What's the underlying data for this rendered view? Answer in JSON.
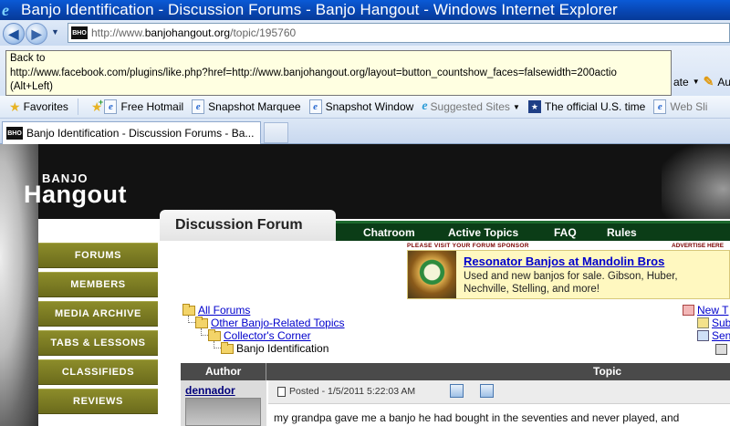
{
  "browser": {
    "window_title": "Banjo Identification - Discussion Forums - Banjo Hangout - Windows Internet Explorer",
    "url_prefix": "http://www.",
    "url_domain": "banjohangout.org",
    "url_path": "/topic/195760",
    "favicon_text": "BHO",
    "tooltip_line1": "Back to",
    "tooltip_line2": "http://www.facebook.com/plugins/like.php?href=http://www.banjohangout.org/layout=button_countshow_faces=falsewidth=200actio",
    "tooltip_line3": "(Alt+Left)",
    "command_page_label": "ate",
    "command_au_label": "Au"
  },
  "favorites_bar": {
    "favorites_label": "Favorites",
    "items": [
      {
        "label": "Free Hotmail",
        "icon": "ie-page-icon"
      },
      {
        "label": "Snapshot Marquee",
        "icon": "ie-page-icon"
      },
      {
        "label": "Snapshot Window",
        "icon": "ie-page-icon"
      },
      {
        "label": "Suggested Sites",
        "icon": "ie-e-icon"
      },
      {
        "label": "The official U.S. time",
        "icon": "usgov-icon"
      },
      {
        "label": "Web Sli",
        "icon": "ie-page-icon"
      }
    ]
  },
  "tabs": [
    {
      "title": "Banjo Identification - Discussion Forums - Ba..."
    }
  ],
  "site": {
    "logo_small": "BANJO",
    "logo_big": "Hangout",
    "sidebar": [
      "FORUMS",
      "MEMBERS",
      "MEDIA ARCHIVE",
      "TABS & LESSONS",
      "CLASSIFIEDS",
      "REVIEWS"
    ],
    "section_title": "Discussion Forum",
    "nav": [
      "Chatroom",
      "Active Topics",
      "FAQ",
      "Rules"
    ],
    "sponsor_label": "PLEASE VISIT YOUR FORUM SPONSOR",
    "advertise_label": "ADVERTISE HERE",
    "ad": {
      "title": "Resonator Banjos at Mandolin Bros",
      "description": "Used and new banjos for sale. Gibson, Huber, Nechville, Stelling, and more!"
    },
    "breadcrumbs": [
      "All Forums",
      "Other Banjo-Related Topics",
      "Collector's Corner",
      "Banjo Identification"
    ],
    "right_links": [
      "New T",
      "Sub",
      "Sen"
    ],
    "table": {
      "author_header": "Author",
      "topic_header": "Topic"
    },
    "post": {
      "author": "dennador",
      "meta": "Posted - 1/5/2011 5:22:03 AM",
      "body": "my grandpa gave me a banjo he had bought in the seventies and never played, and"
    }
  },
  "colors": {
    "title_bar": "#0845b0",
    "sidebar_olive": "#7c7c23",
    "nav_green": "#0b3d17",
    "ad_background": "#fff8c0",
    "link_blue": "#0000cc"
  }
}
